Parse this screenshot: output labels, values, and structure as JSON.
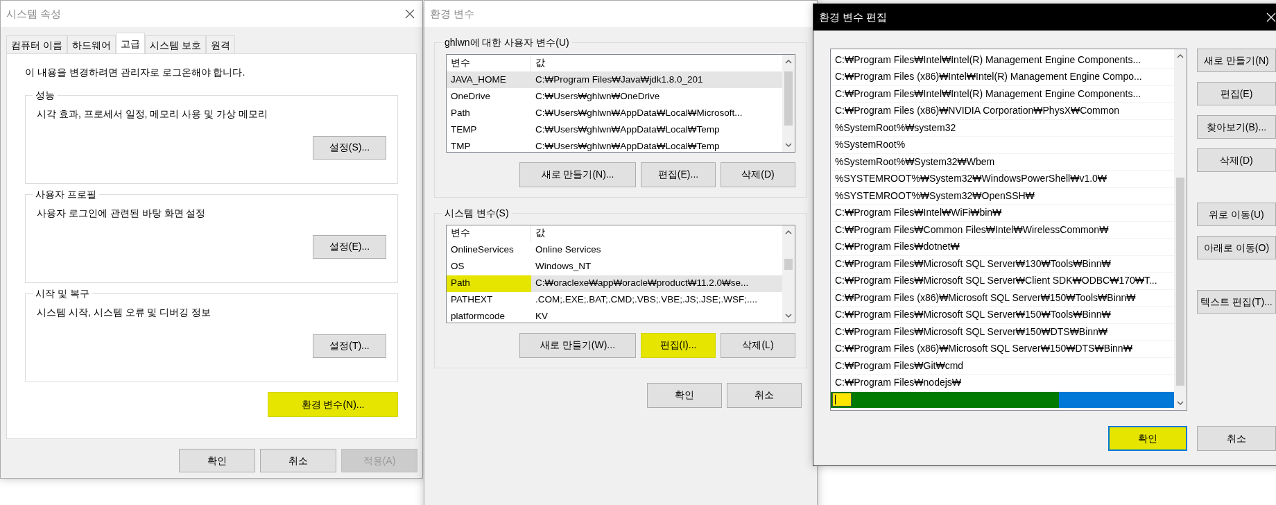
{
  "system_properties": {
    "title": "시스템 속성",
    "tabs": [
      {
        "label": "컴퓨터 이름",
        "selected": false
      },
      {
        "label": "하드웨어",
        "selected": false
      },
      {
        "label": "고급",
        "selected": true
      },
      {
        "label": "시스템 보호",
        "selected": false
      },
      {
        "label": "원격",
        "selected": false
      }
    ],
    "notice": "이 내용을 변경하려면 관리자로 로그온해야 합니다.",
    "groups": [
      {
        "title": "성능",
        "description": "시각 효과, 프로세서 일정, 메모리 사용 및 가상 메모리",
        "button": "설정(S)..."
      },
      {
        "title": "사용자 프로필",
        "description": "사용자 로그인에 관련된 바탕 화면 설정",
        "button": "설정(E)..."
      },
      {
        "title": "시작 및 복구",
        "description": "시스템 시작, 시스템 오류 및 디버깅 정보",
        "button": "설정(T)..."
      }
    ],
    "env_button": {
      "label": "환경 변수(N)...",
      "highlighted": true
    },
    "footer": [
      {
        "label": "확인",
        "disabled": false
      },
      {
        "label": "취소",
        "disabled": false
      },
      {
        "label": "적용(A)",
        "disabled": true
      }
    ]
  },
  "environment_variables": {
    "title": "환경 변수",
    "sections": [
      {
        "title": "ghlwn에 대한 사용자 변수(U)",
        "columns": [
          "변수",
          "값"
        ],
        "rows": [
          {
            "name": "JAVA_HOME",
            "value": "C:₩Program Files₩Java₩jdk1.8.0_201",
            "selected": true,
            "highlighted": false
          },
          {
            "name": "OneDrive",
            "value": "C:₩Users₩ghlwn₩OneDrive",
            "selected": false,
            "highlighted": false
          },
          {
            "name": "Path",
            "value": "C:₩Users₩ghlwn₩AppData₩Local₩Microsoft...",
            "selected": false,
            "highlighted": false
          },
          {
            "name": "TEMP",
            "value": "C:₩Users₩ghlwn₩AppData₩Local₩Temp",
            "selected": false,
            "highlighted": false
          },
          {
            "name": "TMP",
            "value": "C:₩Users₩ghlwn₩AppData₩Local₩Temp",
            "selected": false,
            "highlighted": false
          }
        ],
        "buttons": [
          {
            "label": "새로 만들기(N)...",
            "highlighted": false
          },
          {
            "label": "편집(E)...",
            "highlighted": false
          },
          {
            "label": "삭제(D)",
            "highlighted": false
          }
        ]
      },
      {
        "title": "시스템 변수(S)",
        "columns": [
          "변수",
          "값"
        ],
        "rows": [
          {
            "name": "OnlineServices",
            "value": "Online Services",
            "selected": false,
            "highlighted": false
          },
          {
            "name": "OS",
            "value": "Windows_NT",
            "selected": false,
            "highlighted": false
          },
          {
            "name": "Path",
            "value": "C:₩oraclexe₩app₩oracle₩product₩11.2.0₩se...",
            "selected": true,
            "highlighted": true
          },
          {
            "name": "PATHEXT",
            "value": ".COM;.EXE;.BAT;.CMD;.VBS;.VBE;.JS;.JSE;.WSF;....",
            "selected": false,
            "highlighted": false
          },
          {
            "name": "platformcode",
            "value": "KV",
            "selected": false,
            "highlighted": false
          }
        ],
        "buttons": [
          {
            "label": "새로 만들기(W)...",
            "highlighted": false
          },
          {
            "label": "편집(I)...",
            "highlighted": true
          },
          {
            "label": "삭제(L)",
            "highlighted": false
          }
        ]
      }
    ],
    "footer": [
      "확인",
      "취소"
    ]
  },
  "edit_variable": {
    "title": "환경 변수 편집",
    "entries": [
      {
        "kind": "text",
        "text": "C:₩Program Files₩Intel₩Intel(R) Management Engine Components..."
      },
      {
        "kind": "text",
        "text": "C:₩Program Files (x86)₩Intel₩Intel(R) Management Engine Compo..."
      },
      {
        "kind": "text",
        "text": "C:₩Program Files₩Intel₩Intel(R) Management Engine Components..."
      },
      {
        "kind": "text",
        "text": "C:₩Program Files (x86)₩NVIDIA Corporation₩PhysX₩Common"
      },
      {
        "kind": "text",
        "text": "%SystemRoot%₩system32"
      },
      {
        "kind": "text",
        "text": "%SystemRoot%"
      },
      {
        "kind": "text",
        "text": "%SystemRoot%₩System32₩Wbem"
      },
      {
        "kind": "text",
        "text": "%SYSTEMROOT%₩System32₩WindowsPowerShell₩v1.0₩"
      },
      {
        "kind": "text",
        "text": "%SYSTEMROOT%₩System32₩OpenSSH₩"
      },
      {
        "kind": "text",
        "text": "C:₩Program Files₩Intel₩WiFi₩bin₩"
      },
      {
        "kind": "text",
        "text": "C:₩Program Files₩Common Files₩Intel₩WirelessCommon₩"
      },
      {
        "kind": "text",
        "text": "C:₩Program Files₩dotnet₩"
      },
      {
        "kind": "text",
        "text": "C:₩Program Files₩Microsoft SQL Server₩130₩Tools₩Binn₩"
      },
      {
        "kind": "text",
        "text": "C:₩Program Files₩Microsoft SQL Server₩Client SDK₩ODBC₩170₩T..."
      },
      {
        "kind": "text",
        "text": "C:₩Program Files (x86)₩Microsoft SQL Server₩150₩Tools₩Binn₩"
      },
      {
        "kind": "text",
        "text": "C:₩Program Files₩Microsoft SQL Server₩150₩Tools₩Binn₩"
      },
      {
        "kind": "text",
        "text": "C:₩Program Files₩Microsoft SQL Server₩150₩DTS₩Binn₩"
      },
      {
        "kind": "text",
        "text": "C:₩Program Files (x86)₩Microsoft SQL Server₩150₩DTS₩Binn₩"
      },
      {
        "kind": "text",
        "text": "C:₩Program Files₩Git₩cmd"
      },
      {
        "kind": "text",
        "text": "C:₩Program Files₩nodejs₩"
      },
      {
        "kind": "input",
        "selected": true,
        "highlighted": true
      }
    ],
    "side_button_groups": [
      [
        "새로 만들기(N)",
        "편집(E)",
        "찾아보기(B)...",
        "삭제(D)"
      ],
      [
        "위로 이동(U)",
        "아래로 이동(O)"
      ],
      [
        "텍스트 편집(T)..."
      ]
    ],
    "footer": [
      {
        "label": "확인",
        "highlighted": true
      },
      {
        "label": "취소",
        "highlighted": false
      }
    ]
  }
}
